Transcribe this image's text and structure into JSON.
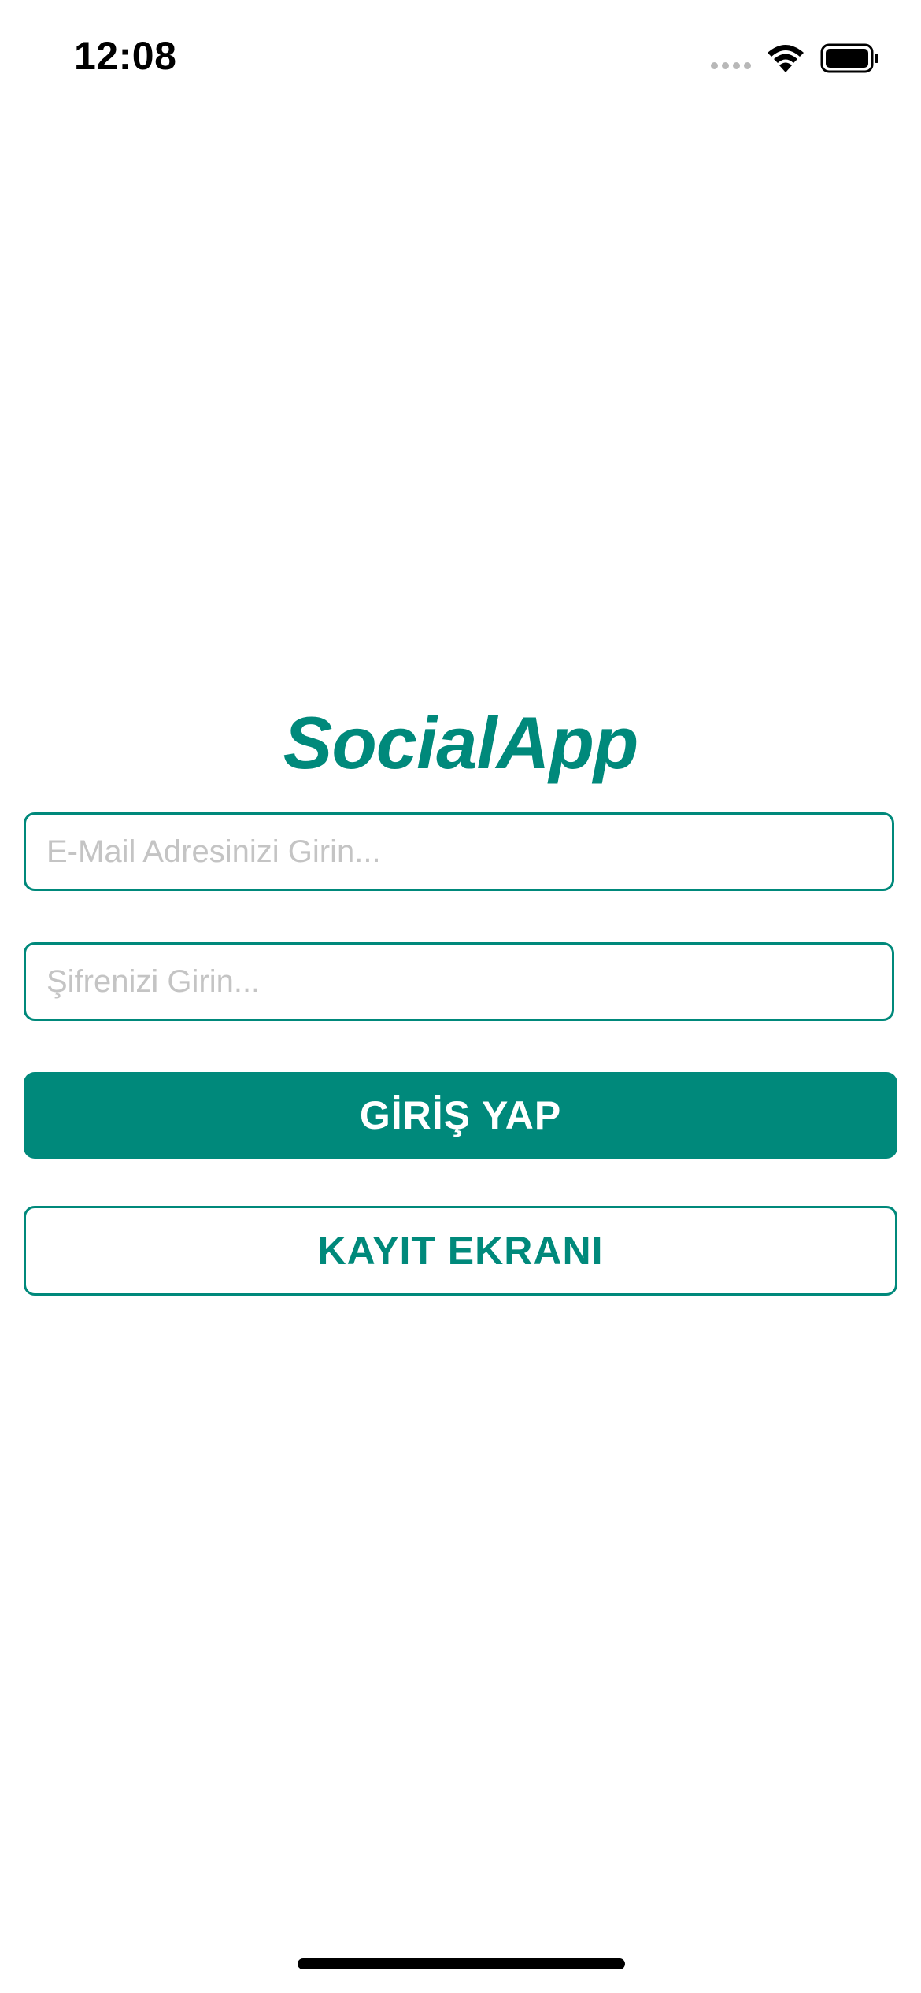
{
  "status_bar": {
    "time": "12:08",
    "icons": [
      "signal-icon",
      "wifi-icon",
      "battery-icon"
    ]
  },
  "login": {
    "title": "SocialApp",
    "email_placeholder": "E-Mail Adresinizi Girin...",
    "email_value": "",
    "password_placeholder": "Şifrenizi Girin...",
    "password_value": "",
    "login_label": "GİRİŞ YAP",
    "register_label": "KAYIT EKRANI"
  },
  "colors": {
    "accent": "#00897b",
    "background": "#ffffff",
    "placeholder": "#c4c4c4"
  }
}
